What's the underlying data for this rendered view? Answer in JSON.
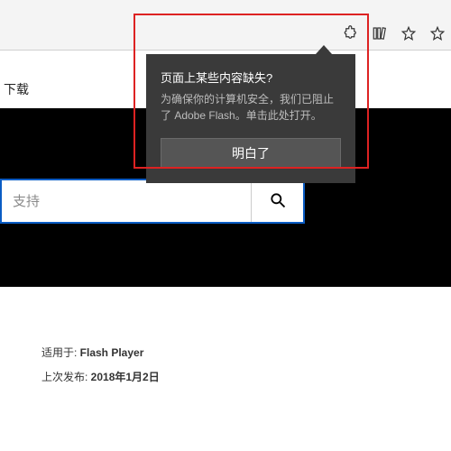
{
  "toolbar": {
    "extension_icon": "extension-icon",
    "library_icon": "library-icon",
    "favorite_icon": "star-icon",
    "favorite2_icon": "star-icon"
  },
  "nav": {
    "downloads": "下载"
  },
  "search": {
    "placeholder": "支持"
  },
  "popup": {
    "title": "页面上某些内容缺失?",
    "body": "为确保你的计算机安全，我们已阻止了 Adobe Flash。单击此处打开。",
    "button": "明白了"
  },
  "info": {
    "applies_label": "适用于: ",
    "applies_value": "Flash Player",
    "published_label": "上次发布: ",
    "published_value": "2018年1月2日"
  }
}
